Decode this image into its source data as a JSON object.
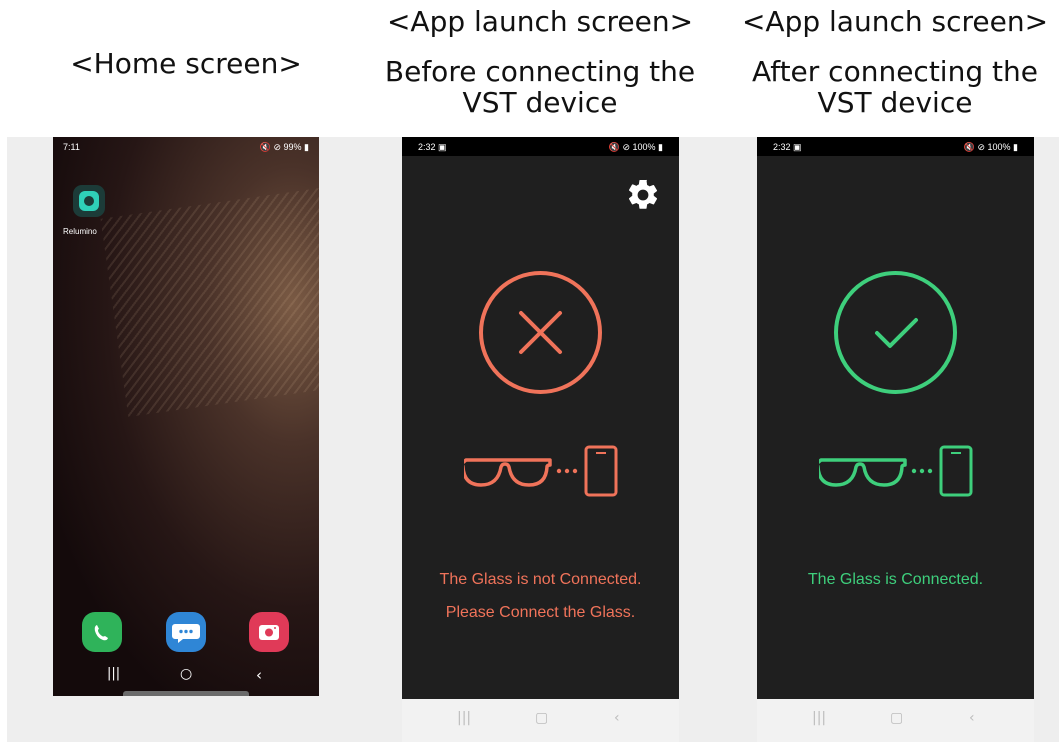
{
  "captions": {
    "home": "<Home screen>",
    "before_line1": "<App launch screen>",
    "before_line2": "Before connecting the",
    "before_line3": "VST device",
    "after_line1": "<App launch screen>",
    "after_line2": "After connecting the",
    "after_line3": "VST device"
  },
  "home_screen": {
    "status_time": "7:11",
    "status_right": "99%",
    "app_label": "Relumino",
    "dock": [
      {
        "name": "phone",
        "color": "#2fb35a"
      },
      {
        "name": "messages",
        "color": "#2f86d6"
      },
      {
        "name": "camera",
        "color": "#e03a58"
      }
    ]
  },
  "before_screen": {
    "status_time": "2:32",
    "status_right": "100%",
    "message_line1": "The Glass is not Connected.",
    "message_line2": "Please Connect the Glass.",
    "accent": "#f0735a"
  },
  "after_screen": {
    "status_time": "2:32",
    "status_right": "100%",
    "message_line1": "The Glass is Connected.",
    "accent": "#3ecf7c"
  },
  "icons": [
    "settings-gear-icon",
    "x-circle-icon",
    "check-circle-icon",
    "glasses-icon",
    "phone-icon"
  ]
}
